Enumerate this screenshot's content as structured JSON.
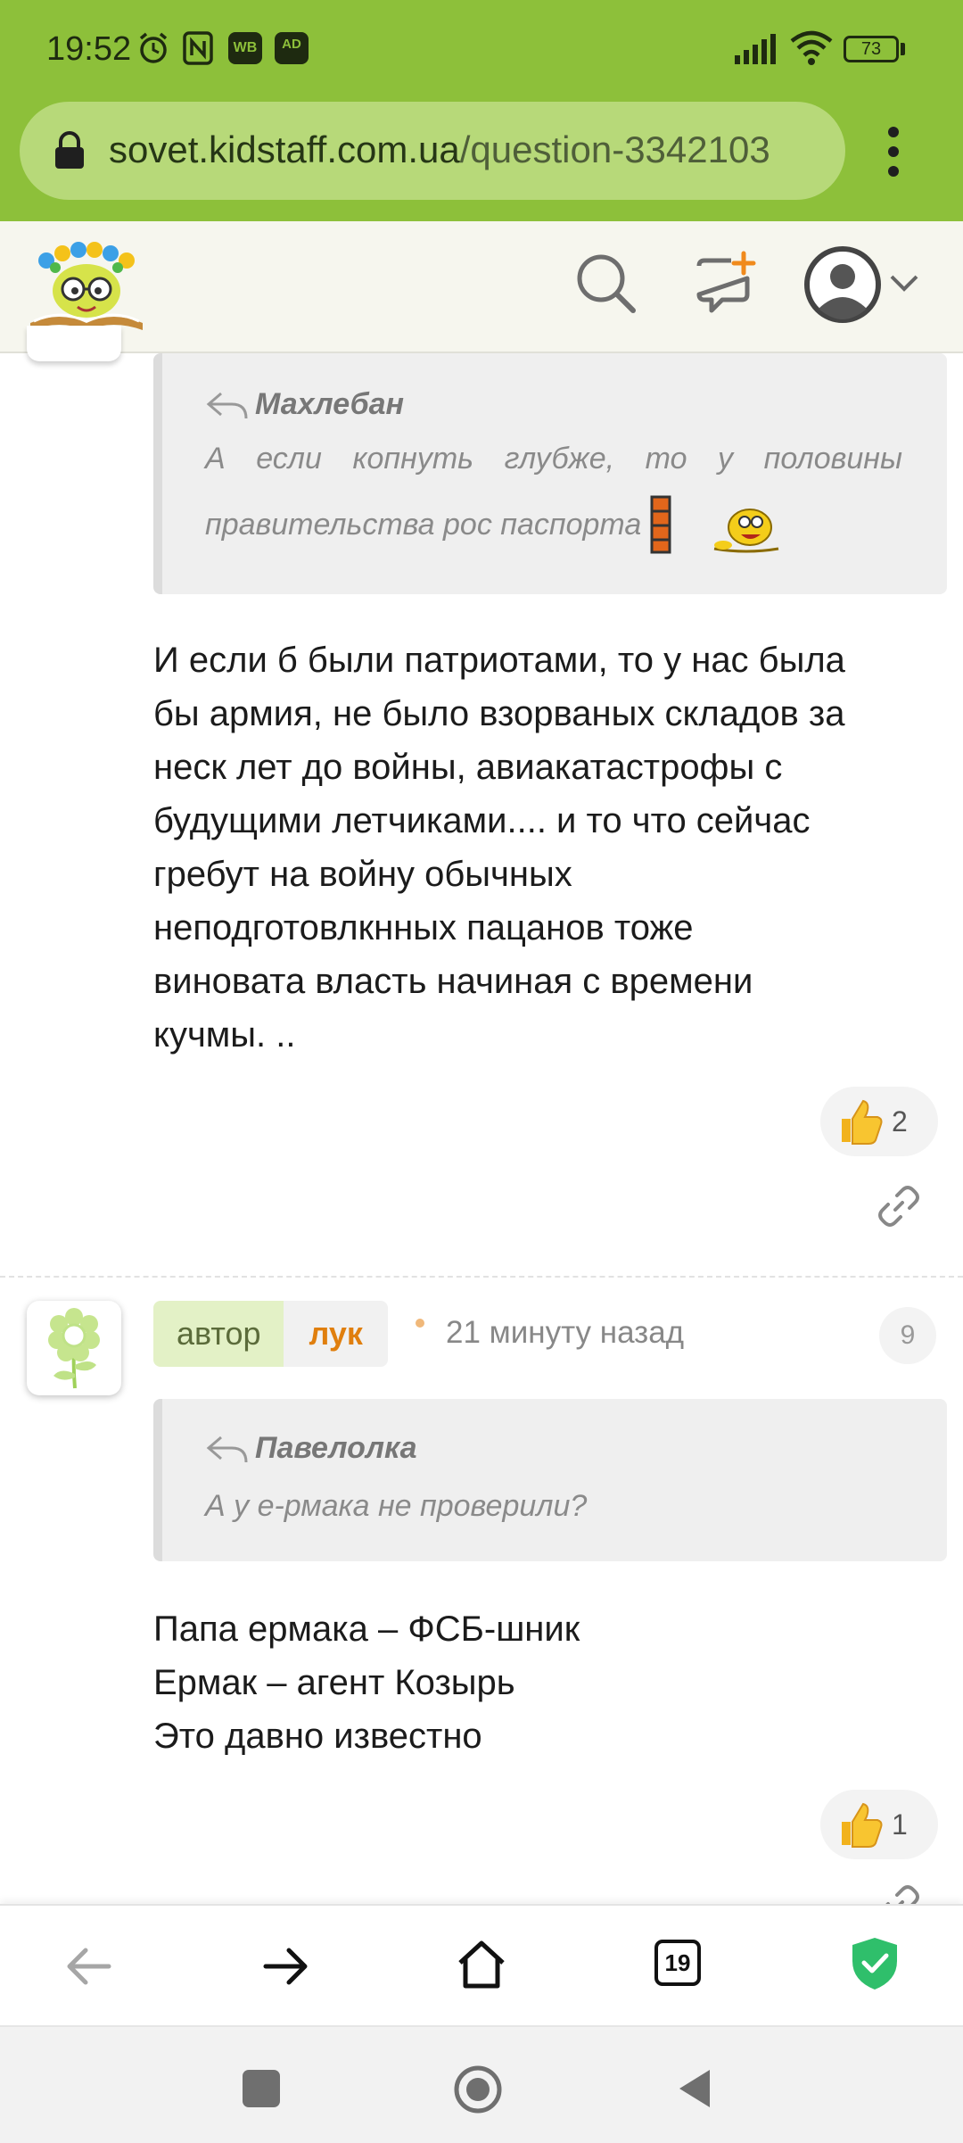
{
  "status_bar": {
    "time": "19:52",
    "battery": "73",
    "icons": [
      "alarm-icon",
      "nfc-icon",
      "wb-icon",
      "adblock-icon",
      "signal-icon",
      "wifi-icon",
      "battery-icon"
    ],
    "wb_label": "WB",
    "ad_label": "AD"
  },
  "browser": {
    "url_domain": "sovet.kidstaff.com.ua",
    "url_path": "/question-3342103",
    "tabs_count": "19"
  },
  "post1": {
    "quote_author": "Махлебан",
    "quote_line1": "А если копнуть глубже, то у половины",
    "quote_line2": "правительства рос паспорта",
    "text_lines": [
      "И если б были патриотами, то у нас была",
      "бы армия, не было взорваных складов за",
      "неск лет до войны, авиакатастрофы с",
      "будущими летчиками.... и то что сейчас",
      "гребут на войну обычных",
      "неподготовлкнных пацанов тоже",
      "виновата власть начиная с времени",
      "кучмы. .."
    ],
    "likes": "2"
  },
  "post2": {
    "author_label": "автор",
    "nickname": "лук",
    "time_ago": "21 минуту назад",
    "number": "9",
    "quote_author": "Павелолка",
    "quote_text": "А у е-рмака не проверили?",
    "text_lines": [
      "Папа ермака – ФСБ-шник",
      "Ермак – агент Козырь",
      "Это давно известно"
    ],
    "likes": "1"
  },
  "colors": {
    "chrome_green": "#8dc03a",
    "nick_orange": "#e07f0e",
    "shield_green": "#2fbf6b"
  }
}
